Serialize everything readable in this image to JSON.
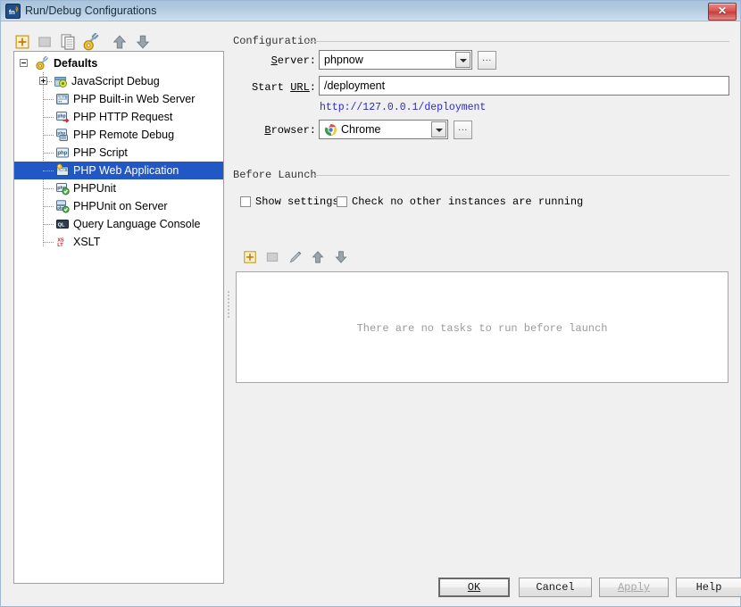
{
  "window": {
    "title": "Run/Debug Configurations",
    "app_icon": "phpstorm-icon",
    "close_label": "✕"
  },
  "toolbar": {
    "items": [
      {
        "name": "add-configuration-button",
        "icon": "plus-icon",
        "tooltip": "Add New Configuration",
        "enabled": true
      },
      {
        "name": "remove-configuration-button",
        "icon": "minus-icon",
        "tooltip": "Remove Configuration",
        "enabled": false
      },
      {
        "name": "copy-configuration-button",
        "icon": "copy-icon",
        "tooltip": "Copy Configuration",
        "enabled": true
      },
      {
        "name": "edit-templates-button",
        "icon": "wrench-icon",
        "tooltip": "Edit Templates",
        "enabled": true
      },
      {
        "name": "move-up-button",
        "icon": "arrow-up-icon",
        "tooltip": "Move Up",
        "enabled": true
      },
      {
        "name": "move-down-button",
        "icon": "arrow-down-icon",
        "tooltip": "Move Down",
        "enabled": true
      }
    ]
  },
  "tree": {
    "root": {
      "label": "Defaults",
      "icon": "wrench-gear-icon",
      "expanded": true
    },
    "items": [
      {
        "label": "JavaScript Debug",
        "icon": "javascript-debug-icon",
        "expandable": true,
        "selected": false
      },
      {
        "label": "PHP Built-in Web Server",
        "icon": "php-builtin-server-icon",
        "expandable": false,
        "selected": false
      },
      {
        "label": "PHP HTTP Request",
        "icon": "php-http-request-icon",
        "expandable": false,
        "selected": false
      },
      {
        "label": "PHP Remote Debug",
        "icon": "php-remote-debug-icon",
        "expandable": false,
        "selected": false
      },
      {
        "label": "PHP Script",
        "icon": "php-script-icon",
        "expandable": false,
        "selected": false
      },
      {
        "label": "PHP Web Application",
        "icon": "php-web-app-icon",
        "expandable": false,
        "selected": true
      },
      {
        "label": "PHPUnit",
        "icon": "phpunit-icon",
        "expandable": false,
        "selected": false
      },
      {
        "label": "PHPUnit on Server",
        "icon": "phpunit-server-icon",
        "expandable": false,
        "selected": false
      },
      {
        "label": "Query Language Console",
        "icon": "sql-console-icon",
        "expandable": false,
        "selected": false
      },
      {
        "label": "XSLT",
        "icon": "xslt-icon",
        "expandable": false,
        "selected": false
      }
    ]
  },
  "configuration": {
    "group_title": "Configuration",
    "server": {
      "label": "Server:",
      "mnemonic": "S",
      "value": "phpnow",
      "browse_label": "..."
    },
    "start_url": {
      "label_prefix": "Start ",
      "label_mnemonic": "URL",
      "label_suffix": ":",
      "value": "/deployment",
      "placeholder": "/"
    },
    "url_preview": "http://127.0.0.1/deployment",
    "browser": {
      "label": "Browser:",
      "mnemonic": "B",
      "value": "Chrome",
      "icon": "chrome-icon",
      "browse_label": "..."
    }
  },
  "before_launch": {
    "group_title": "Before Launch",
    "checkboxes": [
      {
        "name": "show-settings-checkbox",
        "label": "Show settings",
        "checked": false
      },
      {
        "name": "check-no-instances-checkbox",
        "label": "Check no other instances are running",
        "checked": false
      }
    ],
    "task_toolbar": [
      {
        "name": "add-task-button",
        "icon": "plus-icon",
        "enabled": true
      },
      {
        "name": "remove-task-button",
        "icon": "minus-icon",
        "enabled": false
      },
      {
        "name": "edit-task-button",
        "icon": "pencil-icon",
        "enabled": true
      },
      {
        "name": "task-move-up-button",
        "icon": "arrow-up-icon",
        "enabled": true
      },
      {
        "name": "task-move-down-button",
        "icon": "arrow-down-icon",
        "enabled": true
      }
    ],
    "empty_message": "There are no tasks to run before launch"
  },
  "buttons": {
    "ok": {
      "label": "OK",
      "mnemonic": "O",
      "default": true,
      "enabled": true
    },
    "cancel": {
      "label": "Cancel",
      "mnemonic": "",
      "default": false,
      "enabled": true
    },
    "apply": {
      "label": "Apply",
      "mnemonic": "A",
      "default": false,
      "enabled": false
    },
    "help": {
      "label": "Help",
      "mnemonic": "",
      "default": false,
      "enabled": true
    }
  },
  "colors": {
    "selection_blue": "#2258c6",
    "url_link": "#2b2bc4",
    "titlebar_top": "#a9c2dd",
    "titlebar_bottom": "#dceaf6",
    "dialog_bg": "#f0f0f0"
  }
}
